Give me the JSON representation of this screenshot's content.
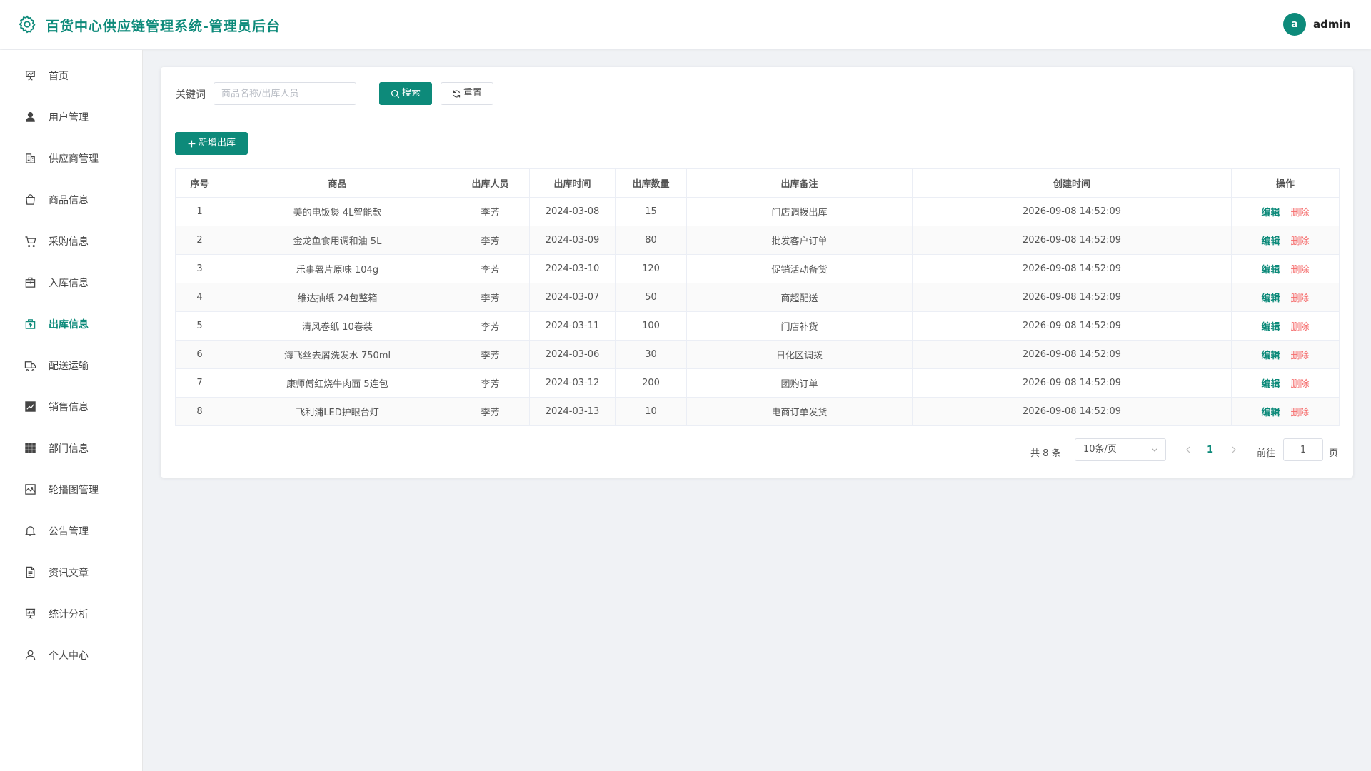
{
  "header": {
    "title": "百货中心供应链管理系统-管理员后台",
    "avatar_letter": "a",
    "username": "admin",
    "accent_color": "#0d8a7a"
  },
  "sidebar": {
    "items": [
      {
        "label": "首页",
        "icon": "presentation-icon"
      },
      {
        "label": "用户管理",
        "icon": "user-icon"
      },
      {
        "label": "供应商管理",
        "icon": "building-icon"
      },
      {
        "label": "商品信息",
        "icon": "shopping-bag-icon"
      },
      {
        "label": "采购信息",
        "icon": "cart-icon"
      },
      {
        "label": "入库信息",
        "icon": "suitcase-icon"
      },
      {
        "label": "出库信息",
        "icon": "box-upload-icon",
        "active": true
      },
      {
        "label": "配送运输",
        "icon": "truck-icon"
      },
      {
        "label": "销售信息",
        "icon": "trend-chart-icon"
      },
      {
        "label": "部门信息",
        "icon": "grid-icon"
      },
      {
        "label": "轮播图管理",
        "icon": "picture-icon"
      },
      {
        "label": "公告管理",
        "icon": "bell-icon"
      },
      {
        "label": "资讯文章",
        "icon": "document-icon"
      },
      {
        "label": "统计分析",
        "icon": "data-board-icon"
      },
      {
        "label": "个人中心",
        "icon": "user-outline-icon"
      }
    ]
  },
  "search": {
    "label": "关键词",
    "placeholder": "商品名称/出库人员",
    "value": "",
    "search_button": "搜索",
    "reset_button": "重置"
  },
  "toolbar": {
    "add_button": "新增出库"
  },
  "table": {
    "columns": [
      "序号",
      "商品",
      "出库人员",
      "出库时间",
      "出库数量",
      "出库备注",
      "创建时间",
      "操作"
    ],
    "rows": [
      [
        "1",
        "美的电饭煲 4L智能款",
        "李芳",
        "2024-03-08",
        "15",
        "门店调拨出库",
        "2026-09-08 14:52:09"
      ],
      [
        "2",
        "金龙鱼食用调和油 5L",
        "李芳",
        "2024-03-09",
        "80",
        "批发客户订单",
        "2026-09-08 14:52:09"
      ],
      [
        "3",
        "乐事薯片原味 104g",
        "李芳",
        "2024-03-10",
        "120",
        "促销活动备货",
        "2026-09-08 14:52:09"
      ],
      [
        "4",
        "维达抽纸 24包整箱",
        "李芳",
        "2024-03-07",
        "50",
        "商超配送",
        "2026-09-08 14:52:09"
      ],
      [
        "5",
        "清风卷纸 10卷装",
        "李芳",
        "2024-03-11",
        "100",
        "门店补货",
        "2026-09-08 14:52:09"
      ],
      [
        "6",
        "海飞丝去屑洗发水 750ml",
        "李芳",
        "2024-03-06",
        "30",
        "日化区调拨",
        "2026-09-08 14:52:09"
      ],
      [
        "7",
        "康师傅红烧牛肉面 5连包",
        "李芳",
        "2024-03-12",
        "200",
        "团购订单",
        "2026-09-08 14:52:09"
      ],
      [
        "8",
        "飞利浦LED护眼台灯",
        "李芳",
        "2024-03-13",
        "10",
        "电商订单发货",
        "2026-09-08 14:52:09"
      ]
    ],
    "edit_label": "编辑",
    "delete_label": "删除"
  },
  "pagination": {
    "total": "共 8 条",
    "page_size": "10条/页",
    "current_page": "1",
    "goto_label": "前往",
    "goto_value": "1",
    "page_unit": "页"
  }
}
